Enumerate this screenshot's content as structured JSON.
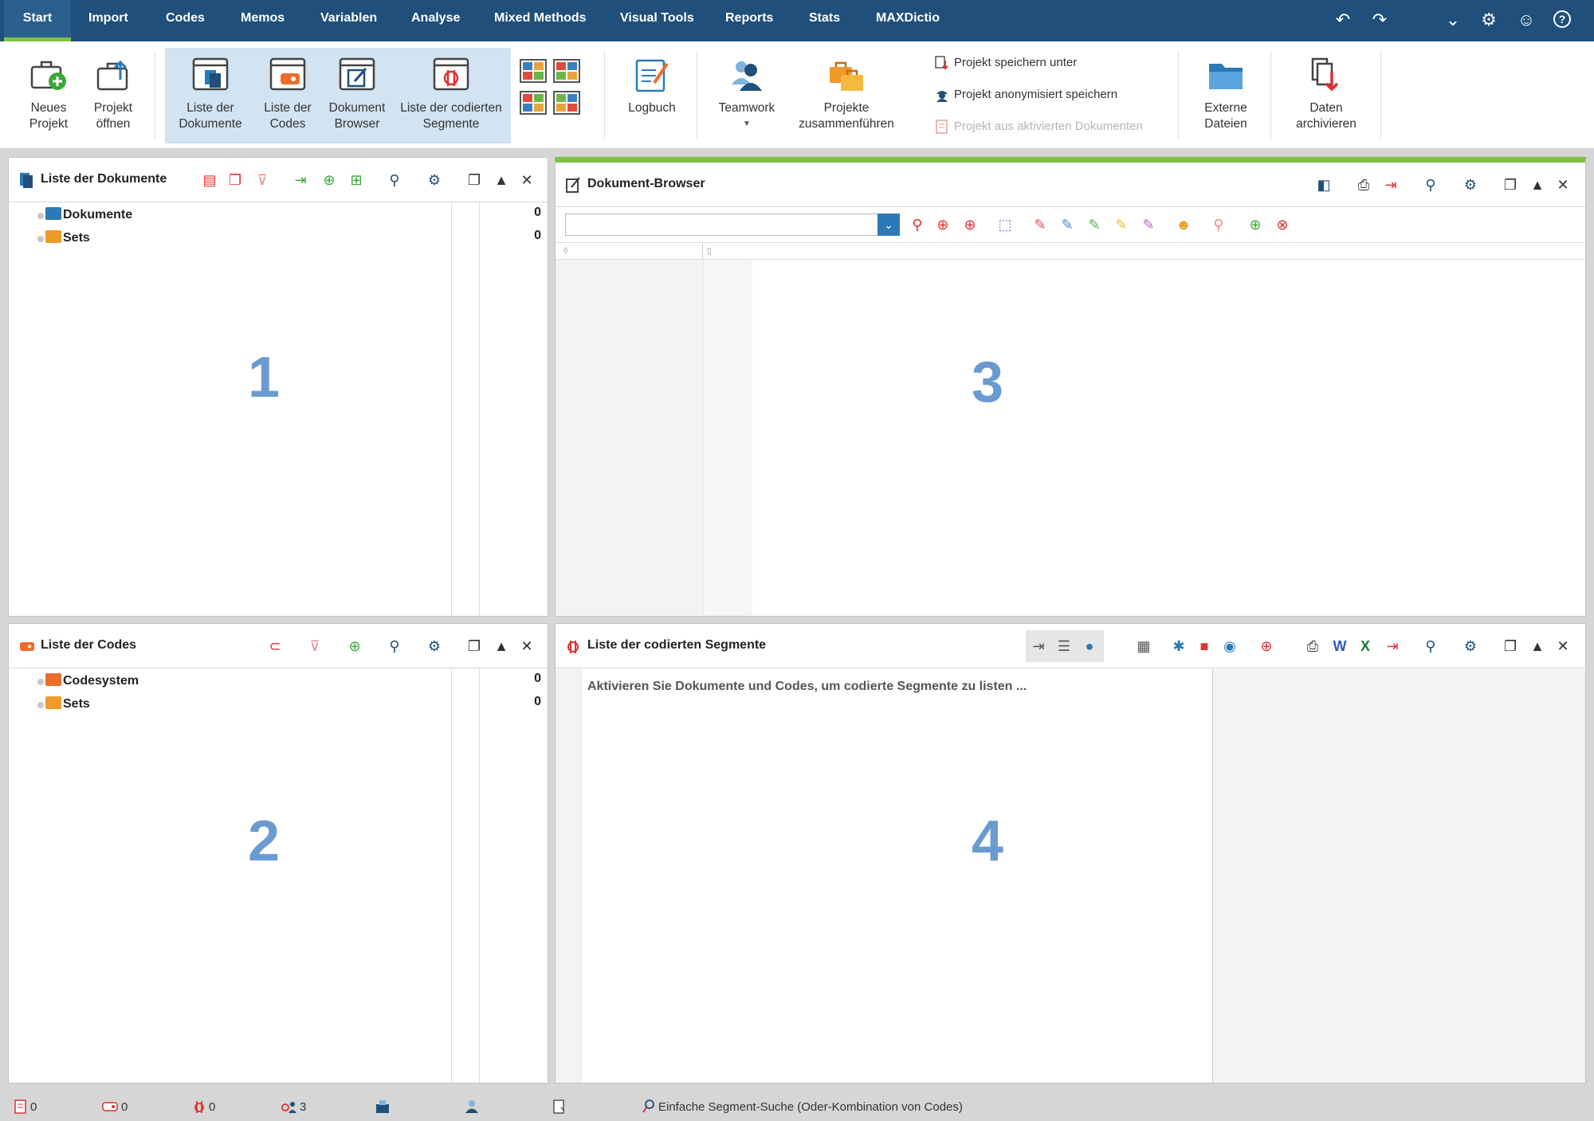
{
  "menu": {
    "tabs": [
      "Start",
      "Import",
      "Codes",
      "Memos",
      "Variablen",
      "Analyse",
      "Mixed Methods",
      "Visual Tools",
      "Reports",
      "Stats",
      "MAXDictio"
    ],
    "active_tab": "Start"
  },
  "ribbon": {
    "new_project": "Neues\nProjekt",
    "open_project": "Projekt\nöffnen",
    "doc_list": "Liste der\nDokumente",
    "code_list": "Liste der\nCodes",
    "doc_browser": "Dokument\nBrowser",
    "coded_segments": "Liste der codierten\nSegmente",
    "logbook": "Logbuch",
    "teamwork": "Teamwork",
    "merge_projects": "Projekte\nzusammenführen",
    "save_as": "Projekt speichern unter",
    "save_anonymized": "Projekt anonymisiert speichern",
    "project_from_docs": "Projekt aus aktivierten Dokumenten",
    "external_files": "Externe\nDateien",
    "archive_data": "Daten\narchivieren"
  },
  "panels": {
    "documents": {
      "title": "Liste der Dokumente",
      "rows": [
        {
          "label": "Dokumente",
          "count": "0"
        },
        {
          "label": "Sets",
          "count": "0"
        }
      ],
      "number": "1"
    },
    "browser": {
      "title": "Dokument-Browser",
      "number": "3"
    },
    "codes": {
      "title": "Liste der Codes",
      "rows": [
        {
          "label": "Codesystem",
          "count": "0"
        },
        {
          "label": "Sets",
          "count": "0"
        }
      ],
      "number": "2"
    },
    "segments": {
      "title": "Liste der codierten Segmente",
      "message": "Aktivieren Sie Dokumente und Codes, um codierte Segmente zu listen ...",
      "number": "4"
    }
  },
  "statusbar": {
    "docs": "0",
    "codes": "0",
    "segments": "0",
    "memos": "3",
    "search": "Einfache Segment-Suche (Oder-Kombination von Codes)"
  },
  "colors": {
    "nav": "#1f4f7a",
    "accent_green": "#7dc242",
    "number_blue": "#6a9bd0",
    "view_group": "#d2e3f1"
  }
}
